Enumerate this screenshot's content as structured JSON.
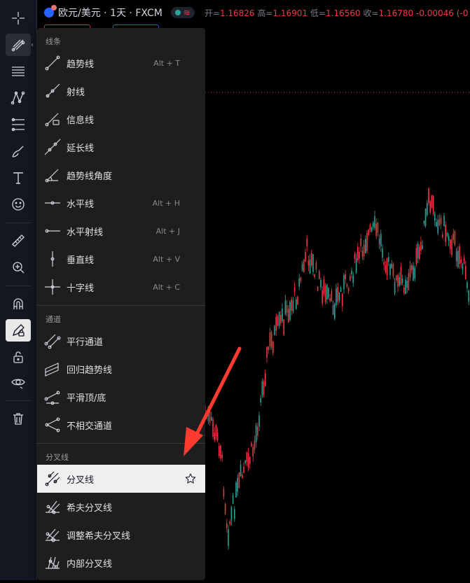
{
  "header": {
    "symbol": "欧元/美元 · 1天 · FXCM",
    "open_label": "开=",
    "open": "1.16826",
    "high_label": "高=",
    "high": "1.16901",
    "low_label": "低=",
    "low": "1.16560",
    "close_label": "收=",
    "close": "1.16780",
    "change": "-0.00046 (-0"
  },
  "toolbar": {
    "icons": [
      "crosshair-icon",
      "trendline-tools-icon",
      "horizontal-lines-icon",
      "pattern-icon",
      "fib-icon",
      "brush-icon",
      "text-icon",
      "emoji-icon",
      "ruler-icon",
      "zoom-in-icon",
      "magnet-icon",
      "lock-pencil-icon",
      "lock-icon",
      "eye-icon",
      "trash-icon"
    ]
  },
  "menu": {
    "sections": [
      {
        "title": "线条",
        "items": [
          {
            "label": "趋势线",
            "hotkey": "Alt + T",
            "icon": "trend-line-icon"
          },
          {
            "label": "射线",
            "hotkey": "",
            "icon": "ray-icon"
          },
          {
            "label": "信息线",
            "hotkey": "",
            "icon": "info-line-icon"
          },
          {
            "label": "延长线",
            "hotkey": "",
            "icon": "extended-line-icon"
          },
          {
            "label": "趋势线角度",
            "hotkey": "",
            "icon": "trend-angle-icon"
          },
          {
            "label": "水平线",
            "hotkey": "Alt + H",
            "icon": "horizontal-line-icon"
          },
          {
            "label": "水平射线",
            "hotkey": "Alt + J",
            "icon": "horizontal-ray-icon"
          },
          {
            "label": "垂直线",
            "hotkey": "Alt + V",
            "icon": "vertical-line-icon"
          },
          {
            "label": "十字线",
            "hotkey": "Alt + C",
            "icon": "cross-line-icon"
          }
        ]
      },
      {
        "title": "通道",
        "items": [
          {
            "label": "平行通道",
            "hotkey": "",
            "icon": "parallel-channel-icon"
          },
          {
            "label": "回归趋势线",
            "hotkey": "",
            "icon": "regression-trend-icon"
          },
          {
            "label": "平滑顶/底",
            "hotkey": "",
            "icon": "flat-top-bottom-icon"
          },
          {
            "label": "不相交通道",
            "hotkey": "",
            "icon": "disjoint-channel-icon"
          }
        ]
      },
      {
        "title": "分叉线",
        "items": [
          {
            "label": "分叉线",
            "hotkey": "",
            "icon": "pitchfork-icon"
          },
          {
            "label": "希夫分叉线",
            "hotkey": "",
            "icon": "schiff-pitchfork-icon"
          },
          {
            "label": "调整希夫分叉线",
            "hotkey": "",
            "icon": "modified-schiff-pitchfork-icon"
          },
          {
            "label": "内部分叉线",
            "hotkey": "",
            "icon": "inside-pitchfork-icon"
          }
        ]
      }
    ]
  },
  "colors": {
    "up": "#26a69a",
    "down": "#f23645",
    "annotation_arrow": "#ff3b30"
  }
}
